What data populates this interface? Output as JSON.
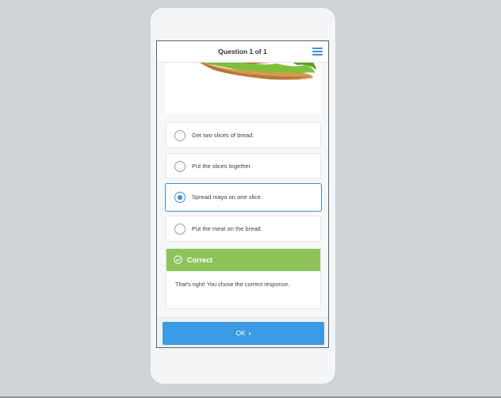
{
  "header": {
    "title": "Question 1 of 1",
    "menu_icon": "hamburger-menu-icon"
  },
  "image": {
    "icon": "sandwich-image"
  },
  "choices": [
    {
      "label": "Get two slices of bread.",
      "selected": false
    },
    {
      "label": "Put the slices together.",
      "selected": false
    },
    {
      "label": "Spread mayo on one slice.",
      "selected": true
    },
    {
      "label": "Put the meat on the bread.",
      "selected": false
    }
  ],
  "feedback": {
    "title": "Correct",
    "icon": "check-circle-icon",
    "message": "That's right! You chose the correct response.",
    "color": "#8dc35b"
  },
  "footer": {
    "ok_label": "OK",
    "chevron": "›"
  },
  "colors": {
    "accent": "#3b9ae4",
    "success": "#8dc35b",
    "background": "#cfd3d7"
  }
}
